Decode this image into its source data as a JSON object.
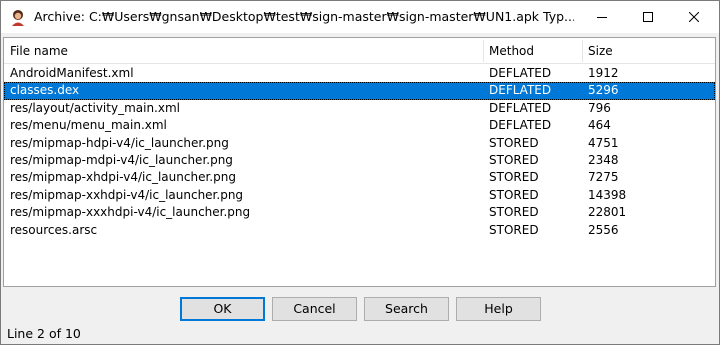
{
  "window": {
    "title": "Archive: C:₩Users₩gnsan₩Desktop₩test₩sign-master₩sign-master₩UN1.apk Typ..."
  },
  "columns": {
    "name": "File name",
    "method": "Method",
    "size": "Size"
  },
  "files": [
    {
      "name": "AndroidManifest.xml",
      "method": "DEFLATED",
      "size": "1912"
    },
    {
      "name": "classes.dex",
      "method": "DEFLATED",
      "size": "5296"
    },
    {
      "name": "res/layout/activity_main.xml",
      "method": "DEFLATED",
      "size": "796"
    },
    {
      "name": "res/menu/menu_main.xml",
      "method": "DEFLATED",
      "size": "464"
    },
    {
      "name": "res/mipmap-hdpi-v4/ic_launcher.png",
      "method": "STORED",
      "size": "4751"
    },
    {
      "name": "res/mipmap-mdpi-v4/ic_launcher.png",
      "method": "STORED",
      "size": "2348"
    },
    {
      "name": "res/mipmap-xhdpi-v4/ic_launcher.png",
      "method": "STORED",
      "size": "7275"
    },
    {
      "name": "res/mipmap-xxhdpi-v4/ic_launcher.png",
      "method": "STORED",
      "size": "14398"
    },
    {
      "name": "res/mipmap-xxxhdpi-v4/ic_launcher.png",
      "method": "STORED",
      "size": "22801"
    },
    {
      "name": "resources.arsc",
      "method": "STORED",
      "size": "2556"
    }
  ],
  "selected_index": 1,
  "buttons": {
    "ok": "OK",
    "cancel": "Cancel",
    "search": "Search",
    "help": "Help"
  },
  "status": "Line 2 of 10",
  "colors": {
    "selection": "#0078d7",
    "window_bg": "#f0f0f0"
  }
}
